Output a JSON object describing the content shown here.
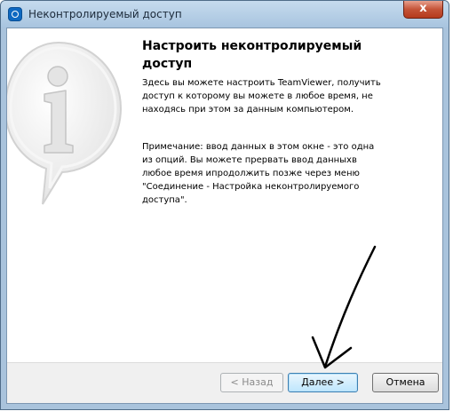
{
  "window": {
    "title": "Неконтролируемый доступ",
    "close_label": "x"
  },
  "content": {
    "heading": "Настроить неконтролируемый доступ",
    "paragraph1": "Здесь вы можете настроить TeamViewer, получить доступ к которому вы можете в любое время, не находясь при этом за данным компьютером.",
    "paragraph2_lines": [
      "Примечание: ввод данных в этом окне  - это одна",
      "из опций. Вы можете прервать ввод данныхв",
      "любое время ипродолжить позже через меню",
      "\"Соединение - Настройка неконтролируемого",
      "доступа\"."
    ]
  },
  "buttons": {
    "back": "< Назад",
    "next": "Далее >",
    "cancel": "Отмена"
  },
  "icons": {
    "app": "teamviewer-icon",
    "info": "info-icon",
    "close": "close-icon",
    "annotation": "arrow-annotation"
  },
  "colors": {
    "accent": "#3c7fb1",
    "close_button": "#c45438",
    "titlebar": "#a8c4df"
  }
}
